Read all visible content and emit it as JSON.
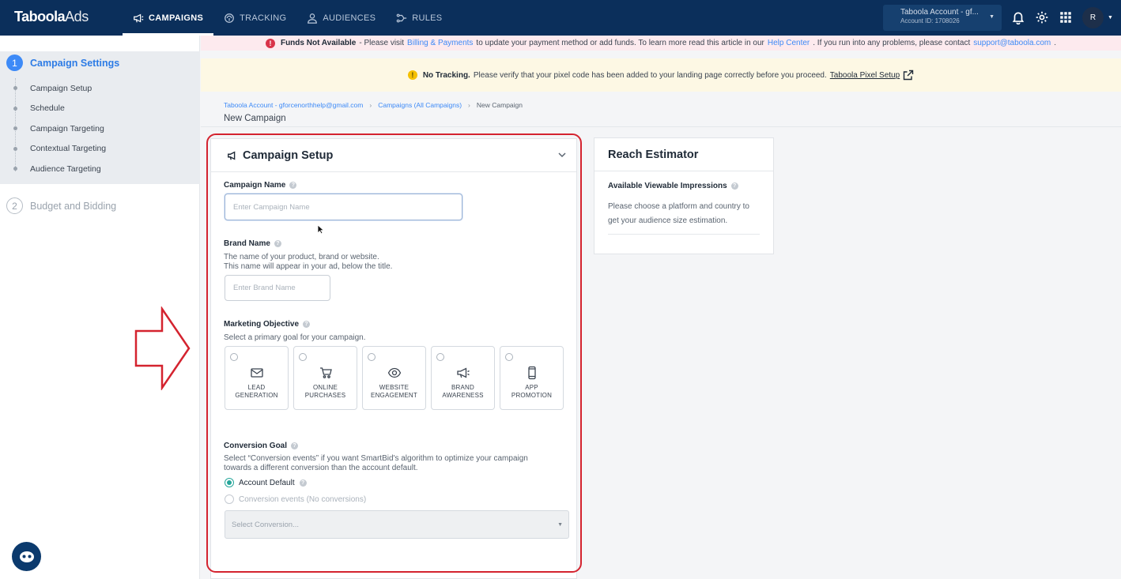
{
  "brand": {
    "logo_main": "Taboola",
    "logo_suffix": "Ads"
  },
  "nav": [
    {
      "label": "CAMPAIGNS",
      "icon": "megaphone-icon",
      "active": true
    },
    {
      "label": "TRACKING",
      "icon": "tracking-icon",
      "active": false
    },
    {
      "label": "AUDIENCES",
      "icon": "person-icon",
      "active": false
    },
    {
      "label": "RULES",
      "icon": "rules-icon",
      "active": false
    }
  ],
  "account": {
    "name": "Taboola Account - gf...",
    "id": "Account ID: 1708026",
    "avatar": "R"
  },
  "sidebar": {
    "step1": {
      "num": "1",
      "label": "Campaign Settings"
    },
    "substeps": [
      "Campaign Setup",
      "Schedule",
      "Campaign Targeting",
      "Contextual Targeting",
      "Audience Targeting"
    ],
    "step2": {
      "num": "2",
      "label": "Budget and Bidding"
    }
  },
  "banners": {
    "funds": {
      "title": "Funds Not Available",
      "t1": "- Please visit",
      "link1": "Billing & Payments",
      "t2": "to update your payment method or add funds. To learn more read this article in our",
      "link2": "Help Center",
      "t3": ". If you run into any problems, please contact",
      "link3": "support@taboola.com",
      "t4": "."
    },
    "tracking": {
      "title": "No Tracking.",
      "text": "Please verify that your pixel code has been added to your landing page correctly before you proceed.",
      "link": "Taboola Pixel Setup"
    }
  },
  "breadcrumb": [
    "Taboola Account - gforcenorthhelp@gmail.com",
    "Campaigns (All Campaigns)",
    "New Campaign"
  ],
  "page_title": "New Campaign",
  "setup": {
    "title": "Campaign Setup",
    "campaign_name": {
      "label": "Campaign Name",
      "placeholder": "Enter Campaign Name",
      "value": ""
    },
    "brand_name": {
      "label": "Brand Name",
      "desc1": "The name of your product, brand or website.",
      "desc2": "This name will appear in your ad, below the title.",
      "placeholder": "Enter Brand Name"
    },
    "objective": {
      "label": "Marketing Objective",
      "desc": "Select a primary goal for your campaign.",
      "options": [
        {
          "l1": "LEAD",
          "l2": "GENERATION",
          "icon": "envelope-icon"
        },
        {
          "l1": "ONLINE",
          "l2": "PURCHASES",
          "icon": "cart-icon"
        },
        {
          "l1": "WEBSITE",
          "l2": "ENGAGEMENT",
          "icon": "eye-icon"
        },
        {
          "l1": "BRAND",
          "l2": "AWARENESS",
          "icon": "megaphone-icon"
        },
        {
          "l1": "APP",
          "l2": "PROMOTION",
          "icon": "phone-icon"
        }
      ]
    },
    "conversion": {
      "label": "Conversion Goal",
      "desc1": "Select “Conversion events” if you want SmartBid's algorithm to optimize your campaign",
      "desc2": "towards a different conversion than the account default.",
      "opt1": "Account Default",
      "opt2": "Conversion events (No conversions)",
      "select_placeholder": "Select Conversion..."
    }
  },
  "reach": {
    "title": "Reach Estimator",
    "subtitle": "Available Viewable Impressions",
    "desc": "Please choose a platform and country to get your audience size estimation."
  },
  "colors": {
    "topbar": "#0b2f5b",
    "accent": "#3d8af7",
    "highlight_frame": "#d4232f",
    "radio_on": "#26a69a"
  }
}
